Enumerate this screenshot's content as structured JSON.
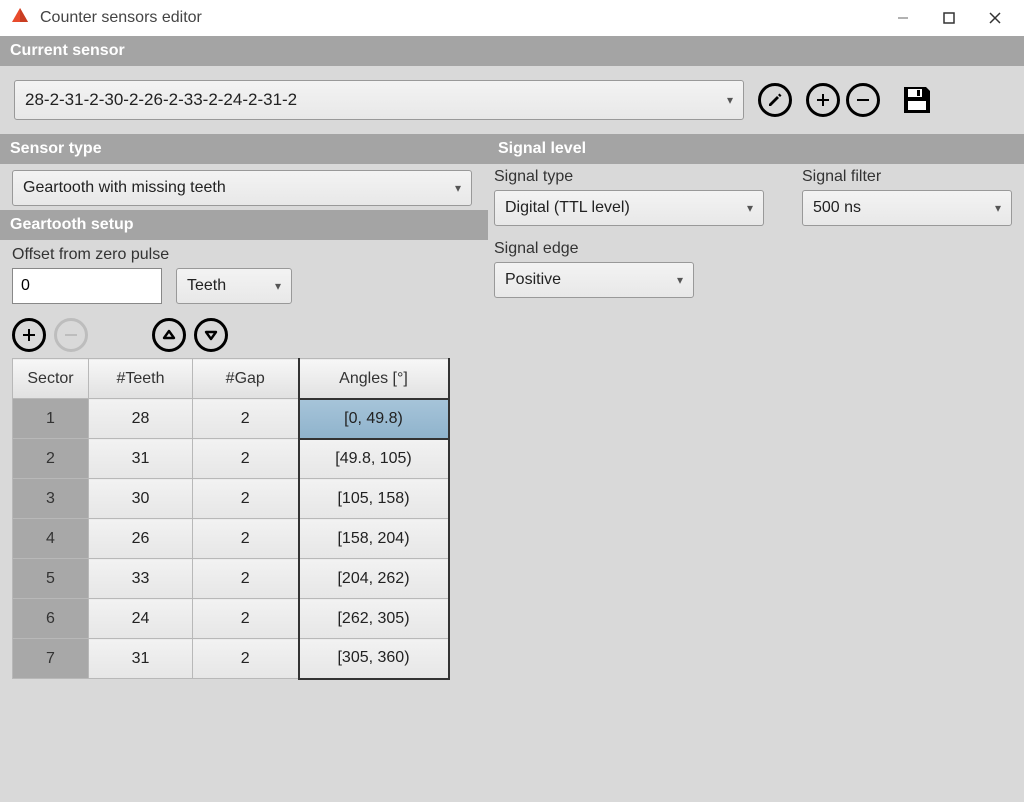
{
  "window": {
    "title": "Counter sensors editor"
  },
  "sections": {
    "current_sensor": "Current sensor",
    "sensor_type": "Sensor type",
    "geartooth_setup": "Geartooth setup",
    "signal_level": "Signal level"
  },
  "current_sensor": {
    "value": "28-2-31-2-30-2-26-2-33-2-24-2-31-2"
  },
  "sensor_type": {
    "value": "Geartooth with missing teeth"
  },
  "geartooth": {
    "offset_label": "Offset from zero pulse",
    "offset_value": "0",
    "offset_unit": "Teeth",
    "columns": {
      "sector": "Sector",
      "teeth": "#Teeth",
      "gap": "#Gap",
      "angles": "Angles [°]"
    },
    "rows": [
      {
        "sector": "1",
        "teeth": "28",
        "gap": "2",
        "angles": "[0, 49.8)",
        "selected": true
      },
      {
        "sector": "2",
        "teeth": "31",
        "gap": "2",
        "angles": "[49.8, 105)"
      },
      {
        "sector": "3",
        "teeth": "30",
        "gap": "2",
        "angles": "[105, 158)"
      },
      {
        "sector": "4",
        "teeth": "26",
        "gap": "2",
        "angles": "[158, 204)"
      },
      {
        "sector": "5",
        "teeth": "33",
        "gap": "2",
        "angles": "[204, 262)"
      },
      {
        "sector": "6",
        "teeth": "24",
        "gap": "2",
        "angles": "[262, 305)"
      },
      {
        "sector": "7",
        "teeth": "31",
        "gap": "2",
        "angles": "[305, 360)"
      }
    ]
  },
  "signal": {
    "type_label": "Signal type",
    "type_value": "Digital (TTL level)",
    "filter_label": "Signal filter",
    "filter_value": "500 ns",
    "edge_label": "Signal edge",
    "edge_value": "Positive"
  }
}
